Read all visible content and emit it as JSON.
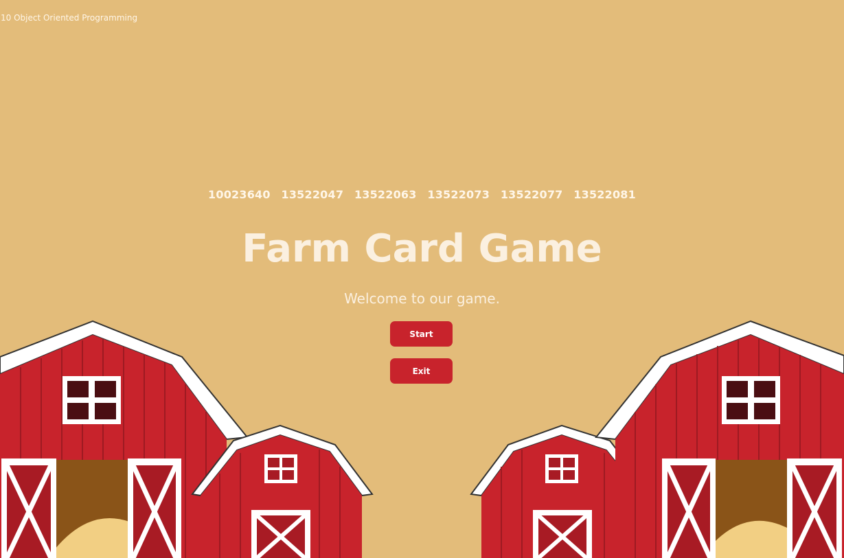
{
  "window": {
    "title": "10 Object Oriented Programming"
  },
  "menu": {
    "student_ids": [
      "10023640",
      "13522047",
      "13522063",
      "13522073",
      "13522077",
      "13522081"
    ],
    "title": "Farm Card Game",
    "subtitle": "Welcome to our game.",
    "start_label": "Start",
    "exit_label": "Exit"
  },
  "colors": {
    "background": "#E3BC7A",
    "button": "#C8232C",
    "text": "#FBF0E0",
    "barn_red": "#C8232C",
    "barn_trim": "#FFFFFF"
  }
}
